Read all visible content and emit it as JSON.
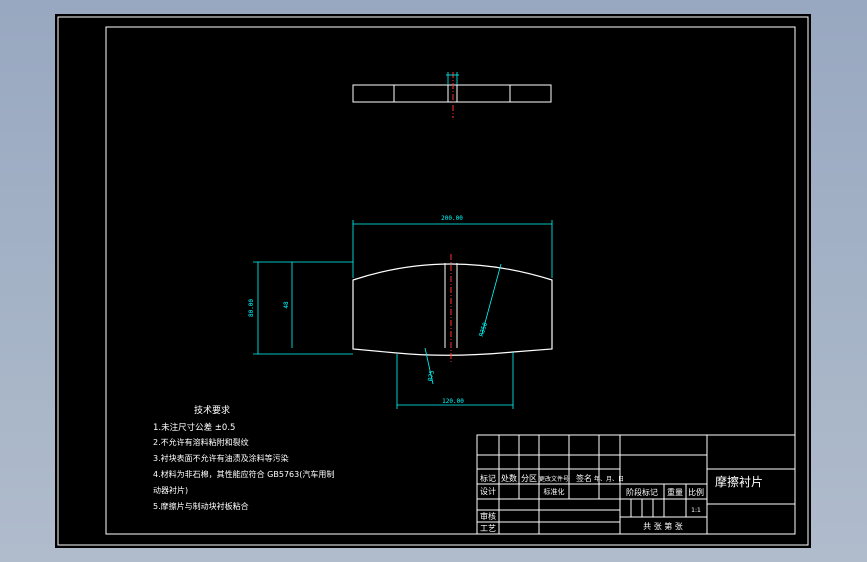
{
  "title": "摩擦衬片",
  "dimensions": {
    "top_width": "200.00",
    "height_outer": "80.00",
    "height_inner": "48",
    "bottom_width": "120.00",
    "arc_radius": "R350",
    "bottom_radius": "R75"
  },
  "tech_requirements": {
    "heading": "技术要求",
    "items": [
      "1.未注尺寸公差 ±0.5",
      "2.不允许有溶料粘附和裂纹",
      "3.衬块表面不允许有油渍及涂料等污染",
      "4.材料为非石棉，其性能应符合 GB5763(汽车用制",
      "动器衬片)",
      "5.摩擦片与制动块衬板粘合"
    ]
  },
  "title_block": {
    "row1_labels": [
      "标记",
      "处数",
      "分区",
      "更改文件号",
      "签名",
      "年、月、日"
    ],
    "design_label": "设计",
    "standardize_label": "标准化",
    "review_label": "审核",
    "process_label": "工艺",
    "stage_label": "阶段标记",
    "weight_label": "重量",
    "scale_label": "比例",
    "scale_value": "1:1",
    "sheet_label": "共 张 第 张"
  }
}
